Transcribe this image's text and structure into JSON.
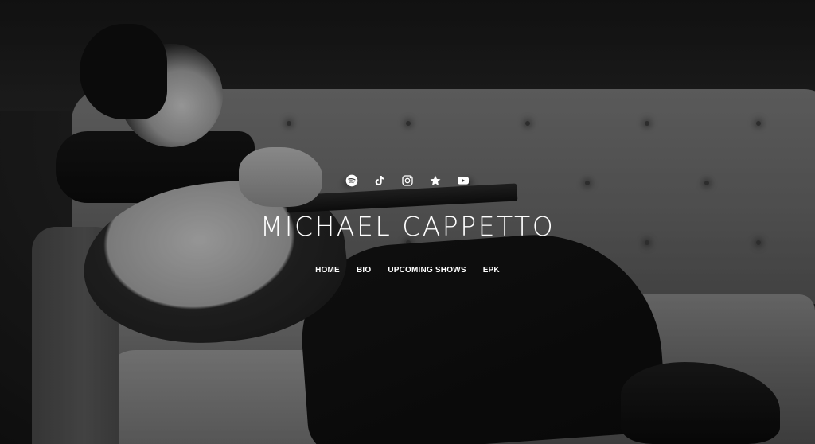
{
  "site": {
    "title": "MICHAEL CAPPETTO"
  },
  "social": [
    {
      "name": "spotify",
      "icon": "spotify-icon"
    },
    {
      "name": "tiktok",
      "icon": "tiktok-icon"
    },
    {
      "name": "instagram",
      "icon": "instagram-icon"
    },
    {
      "name": "star",
      "icon": "star-icon"
    },
    {
      "name": "youtube",
      "icon": "youtube-icon"
    }
  ],
  "nav": {
    "items": [
      {
        "label": "HOME"
      },
      {
        "label": "BIO"
      },
      {
        "label": "UPCOMING SHOWS"
      },
      {
        "label": "EPK"
      }
    ]
  },
  "colors": {
    "text": "#ffffff",
    "background": "#1c1c1c"
  }
}
